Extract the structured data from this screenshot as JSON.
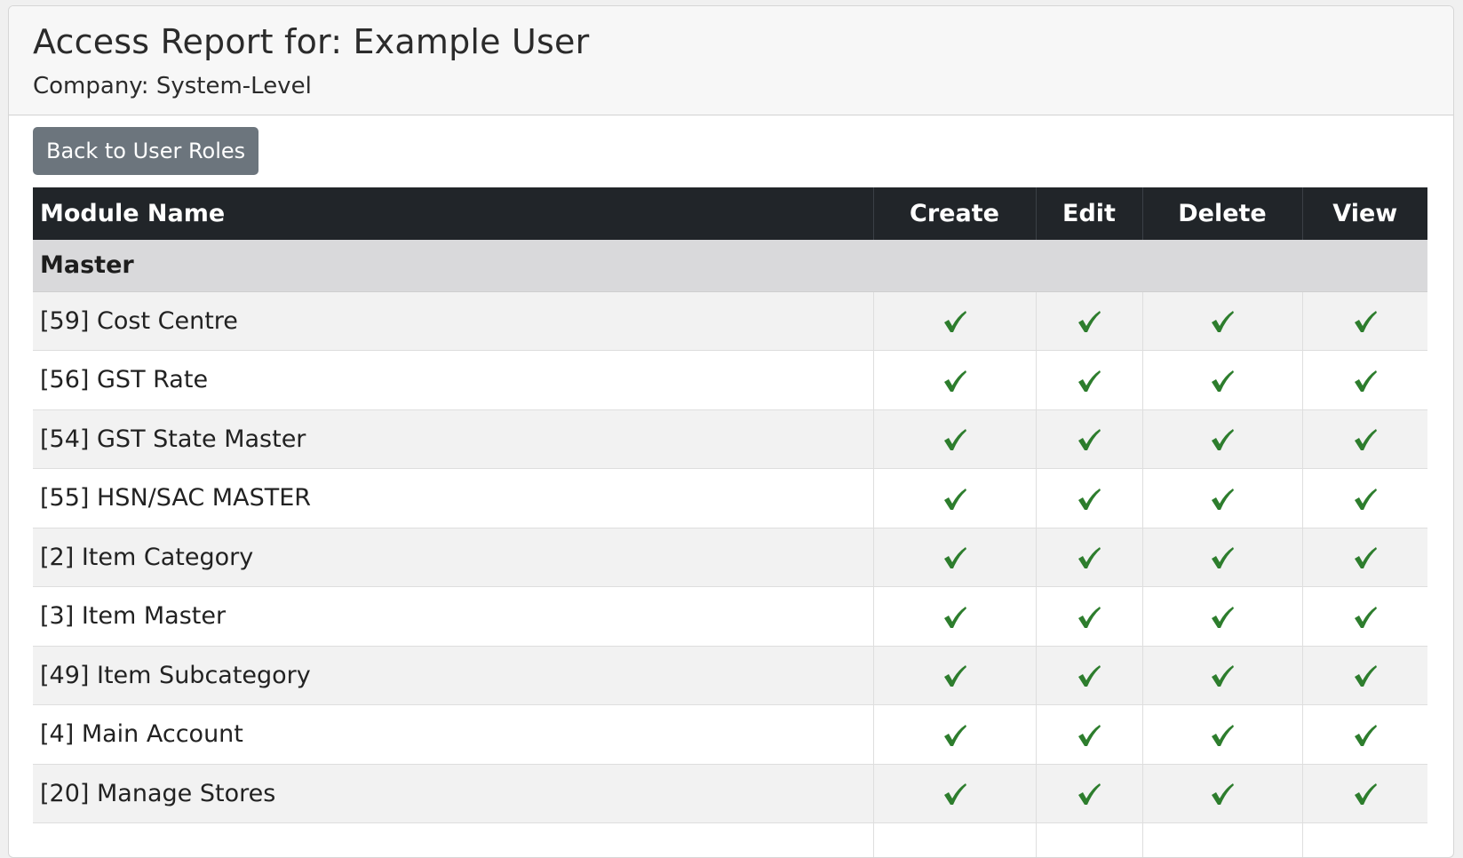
{
  "header": {
    "title": "Access Report for: Example User",
    "company": "Company: System-Level"
  },
  "actions": {
    "back_label": "Back to User Roles"
  },
  "colors": {
    "check": "#2d7d2d",
    "table_header_bg": "#212529",
    "button_bg": "#6c757d"
  },
  "table": {
    "columns": [
      "Module Name",
      "Create",
      "Edit",
      "Delete",
      "View"
    ],
    "group": "Master",
    "rows": [
      {
        "name": "[59] Cost Centre",
        "create": "check-icon",
        "edit": "check-icon",
        "delete": "check-icon",
        "view": "check-icon"
      },
      {
        "name": "[56] GST Rate",
        "create": "check-icon",
        "edit": "check-icon",
        "delete": "check-icon",
        "view": "check-icon"
      },
      {
        "name": "[54] GST State Master",
        "create": "check-icon",
        "edit": "check-icon",
        "delete": "check-icon",
        "view": "check-icon"
      },
      {
        "name": "[55] HSN/SAC MASTER",
        "create": "check-icon",
        "edit": "check-icon",
        "delete": "check-icon",
        "view": "check-icon"
      },
      {
        "name": "[2] Item Category",
        "create": "check-icon",
        "edit": "check-icon",
        "delete": "check-icon",
        "view": "check-icon"
      },
      {
        "name": "[3] Item Master",
        "create": "check-icon",
        "edit": "check-icon",
        "delete": "check-icon",
        "view": "check-icon"
      },
      {
        "name": "[49] Item Subcategory",
        "create": "check-icon",
        "edit": "check-icon",
        "delete": "check-icon",
        "view": "check-icon"
      },
      {
        "name": "[4] Main Account",
        "create": "check-icon",
        "edit": "check-icon",
        "delete": "check-icon",
        "view": "check-icon"
      },
      {
        "name": "[20] Manage Stores",
        "create": "check-icon",
        "edit": "check-icon",
        "delete": "check-icon",
        "view": "check-icon"
      },
      {
        "name": "",
        "create": "",
        "edit": "",
        "delete": "",
        "view": ""
      }
    ]
  }
}
